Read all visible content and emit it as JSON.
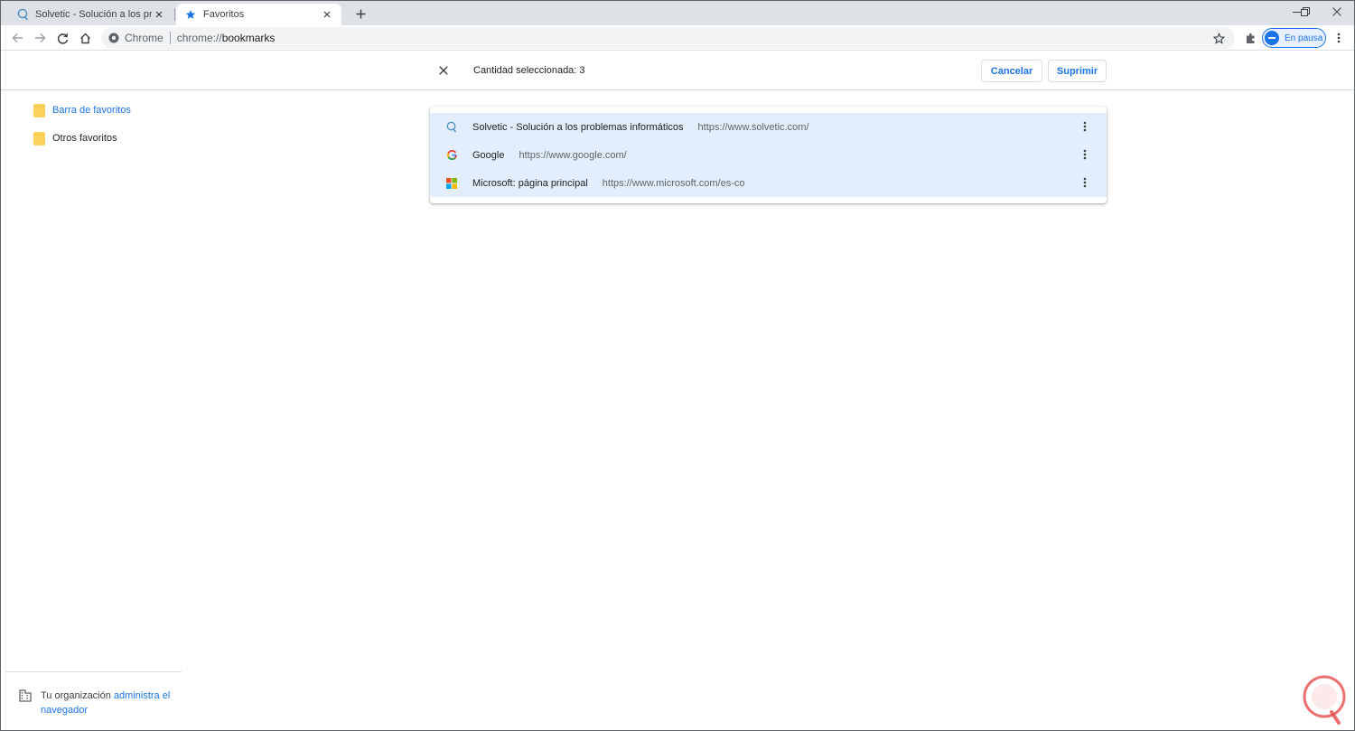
{
  "tabs": [
    {
      "title": "Solvetic - Solución a los problem",
      "favicon": "solvetic-logo-icon",
      "active": false
    },
    {
      "title": "Favoritos",
      "favicon": "star-icon",
      "active": true
    }
  ],
  "toolbar": {
    "omnibox_chrome_label": "Chrome",
    "omnibox_scheme": "chrome://",
    "omnibox_path": "bookmarks",
    "profile_status": "En pausa"
  },
  "selection_bar": {
    "count_text": "Cantidad seleccionada: 3",
    "cancel_label": "Cancelar",
    "delete_label": "Suprimir"
  },
  "sidebar": {
    "folders": [
      {
        "label": "Barra de favoritos",
        "selected": true
      },
      {
        "label": "Otros favoritos",
        "selected": false
      }
    ],
    "managed_prefix": "Tu organización",
    "managed_link": "administra el navegador"
  },
  "bookmarks": [
    {
      "title": "Solvetic - Solución a los problemas informáticos",
      "url": "https://www.solvetic.com/",
      "favicon": "solvetic-logo-icon"
    },
    {
      "title": "Google",
      "url": "https://www.google.com/",
      "favicon": "google-g-icon"
    },
    {
      "title": "Microsoft: página principal",
      "url": "https://www.microsoft.com/es-co",
      "favicon": "microsoft-logo-icon"
    }
  ],
  "colors": {
    "accent": "#1a73e8",
    "selected_row": "#e3eefc",
    "tabstrip": "#dee1e6",
    "folder": "#fbd35c"
  }
}
